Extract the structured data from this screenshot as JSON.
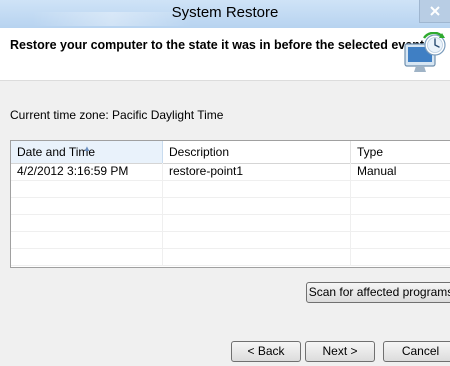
{
  "window": {
    "title": "System Restore"
  },
  "header": {
    "heading": "Restore your computer to the state it was in before the selected event",
    "icon": "system-restore-icon"
  },
  "timezone_text": "Current time zone: Pacific Daylight Time",
  "table": {
    "columns": [
      "Date and Time",
      "Description",
      "Type"
    ],
    "rows": [
      {
        "date": "4/2/2012 3:16:59 PM",
        "description": "restore-point1",
        "type": "Manual"
      }
    ]
  },
  "buttons": {
    "scan": "Scan for affected programs",
    "back": "< Back",
    "next": "Next >",
    "cancel": "Cancel"
  },
  "colors": {
    "titlebar": "#c3dbf4",
    "selected_header": "#e9f2fb"
  }
}
